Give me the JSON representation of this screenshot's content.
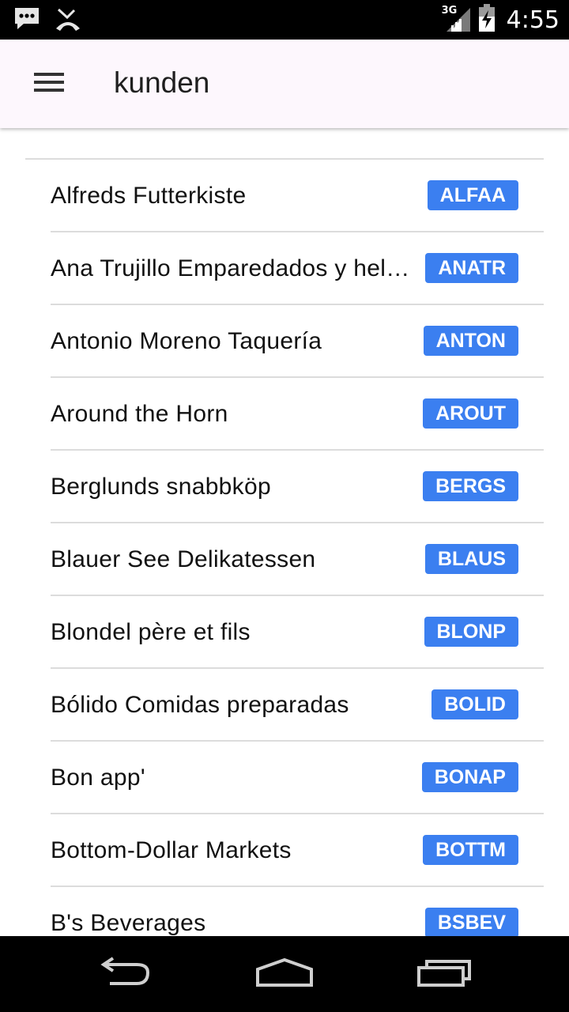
{
  "status_bar": {
    "network_type": "3G",
    "time": "4:55",
    "icons": [
      "message-notification-icon",
      "missed-call-icon",
      "signal-icon",
      "battery-icon"
    ]
  },
  "app_bar": {
    "title": "kunden",
    "menu_icon": "hamburger-menu-icon"
  },
  "customers": [
    {
      "name": "Alfreds Futterkiste",
      "code": "ALFAA"
    },
    {
      "name": "Ana Trujillo Emparedados y helados",
      "code": "ANATR"
    },
    {
      "name": "Antonio Moreno Taquería",
      "code": "ANTON"
    },
    {
      "name": "Around the Horn",
      "code": "AROUT"
    },
    {
      "name": "Berglunds snabbköp",
      "code": "BERGS"
    },
    {
      "name": "Blauer See Delikatessen",
      "code": "BLAUS"
    },
    {
      "name": "Blondel père et fils",
      "code": "BLONP"
    },
    {
      "name": "Bólido Comidas preparadas",
      "code": "BOLID"
    },
    {
      "name": "Bon app'",
      "code": "BONAP"
    },
    {
      "name": "Bottom-Dollar Markets",
      "code": "BOTTM"
    },
    {
      "name": "B's Beverages",
      "code": "BSBEV"
    }
  ],
  "nav_bar": {
    "icons": [
      "back-icon",
      "home-icon",
      "recent-apps-icon"
    ]
  },
  "colors": {
    "badge": "#3b7ff0",
    "app_bar_bg": "#fdf7fd",
    "divider": "#dcdcdc"
  }
}
